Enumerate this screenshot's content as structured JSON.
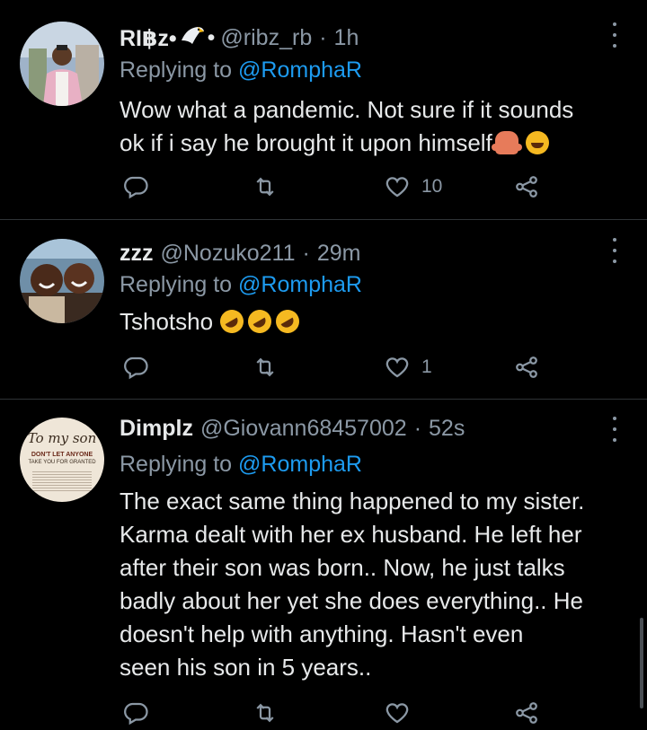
{
  "tweets": [
    {
      "name": "RI฿z•",
      "badge": "eagle-icon",
      "handle": "@ribz_rb",
      "time": "1h",
      "replying_prefix": "Replying to",
      "replying_to": "@RomphaR",
      "lines": [
        "Wow what a pandemic. Not sure if it sounds",
        "ok if i say he brought it upon himself"
      ],
      "trailing_emojis": [
        "person-shrugging-emoji",
        "face-with-tears-of-joy-emoji"
      ],
      "likes": "10"
    },
    {
      "name": "zzz",
      "handle": "@Nozuko211",
      "time": "29m",
      "replying_prefix": "Replying to",
      "replying_to": "@RomphaR",
      "lines": [
        "Tshotsho"
      ],
      "trailing_emojis": [
        "rofl-emoji",
        "rofl-emoji",
        "rofl-emoji"
      ],
      "likes": "1"
    },
    {
      "name": "Dimplz",
      "handle": "@Giovann68457002",
      "time": "52s",
      "replying_prefix": "Replying to",
      "replying_to": "@RomphaR",
      "lines": [
        "The exact same thing happened to my sister.",
        "Karma dealt with her ex husband. He left her",
        "after their son was born.. Now, he just talks",
        "badly about her yet she does everything.. He",
        "doesn't help with anything. Hasn't even",
        "seen his son in 5 years.."
      ],
      "avatar_text": {
        "line1": "To my son",
        "line2": "DON'T LET ANYONE",
        "line3": "TAKE YOU FOR GRANTED"
      }
    }
  ],
  "separator": "·",
  "colors": {
    "background": "#000000",
    "text": "#e7e9ea",
    "muted": "#8b98a5",
    "accent": "#1d9bf0",
    "divider": "#2f3336"
  }
}
